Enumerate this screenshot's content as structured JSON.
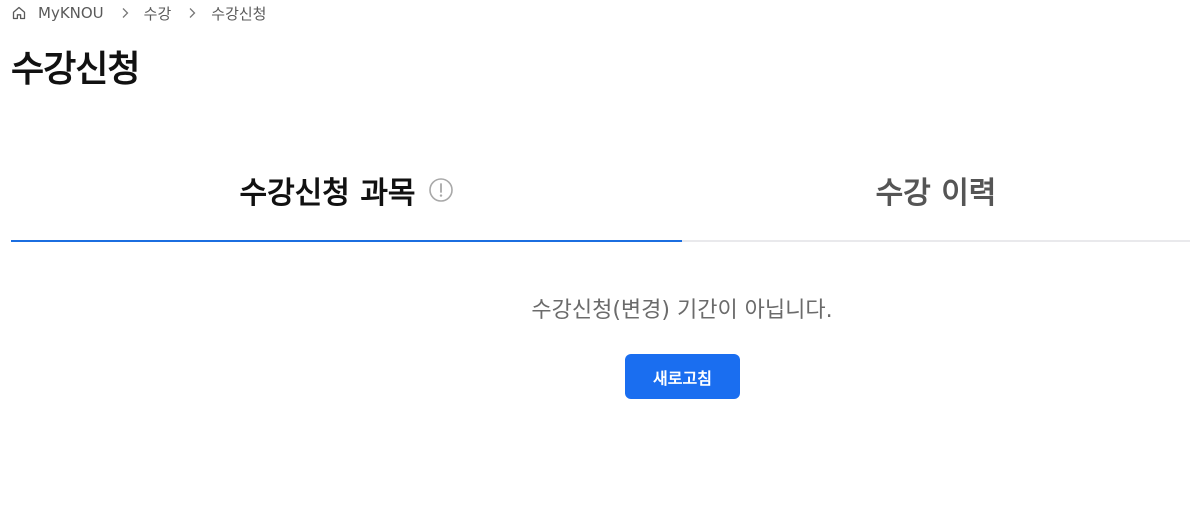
{
  "breadcrumb": {
    "home_icon": "home-icon",
    "items": [
      "MyKNOU",
      "수강",
      "수강신청"
    ]
  },
  "page": {
    "title": "수강신청"
  },
  "tabs": [
    {
      "label": "수강신청 과목",
      "active": true,
      "icon": "info-icon"
    },
    {
      "label": "수강 이력",
      "active": false
    }
  ],
  "main": {
    "message": "수강신청(변경) 기간이 아닙니다.",
    "refresh_label": "새로고침"
  },
  "colors": {
    "accent": "#1a6ef0",
    "tab_indicator": "#1b6ee0",
    "text_primary": "#111111",
    "text_muted": "#6b6b6b"
  }
}
